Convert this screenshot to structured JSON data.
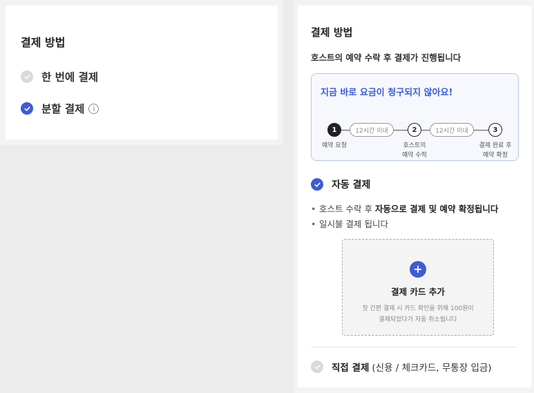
{
  "left": {
    "title": "결제 방법",
    "options": [
      {
        "label": "한 번에 결제",
        "selected": false
      },
      {
        "label": "분할 결제",
        "selected": true,
        "info": "i"
      }
    ]
  },
  "right": {
    "title": "결제 방법",
    "subtitle": "호스트의 예약 수락 후 결제가 진행됩니다",
    "notice": {
      "title": "지금 바로 요금이 청구되지 않아요!",
      "steps": [
        {
          "num": "1",
          "label1": "예약 요청",
          "label2": ""
        },
        {
          "num": "2",
          "label1": "호스트의",
          "label2": "예약 수락"
        },
        {
          "num": "3",
          "label1": "결제 완료 후",
          "label2": "예약 확정"
        }
      ],
      "durations": [
        "12시간 이내",
        "12시간 이내"
      ]
    },
    "auto": {
      "label": "자동 결제",
      "bullet1_pre": "호스트 수락 후 ",
      "bullet1_bold": "자동으로 결제 및 예약 확정됩니다",
      "bullet2": "일시불 결제 됩니다"
    },
    "card_add": {
      "plus": "+",
      "title": "결제 카드 추가",
      "desc_line1": "첫 간편 결제 시 카드 확인을 위해 100원이",
      "desc_line2": "결제되었다가 자동 취소됩니다"
    },
    "direct": {
      "label": "직접 결제",
      "detail": "(신용 / 체크카드, 무통장 입금)"
    }
  },
  "colors": {
    "accent": "#3f5bd6",
    "notice_border": "#b7c6e8",
    "unchecked": "#d9d9d9"
  }
}
